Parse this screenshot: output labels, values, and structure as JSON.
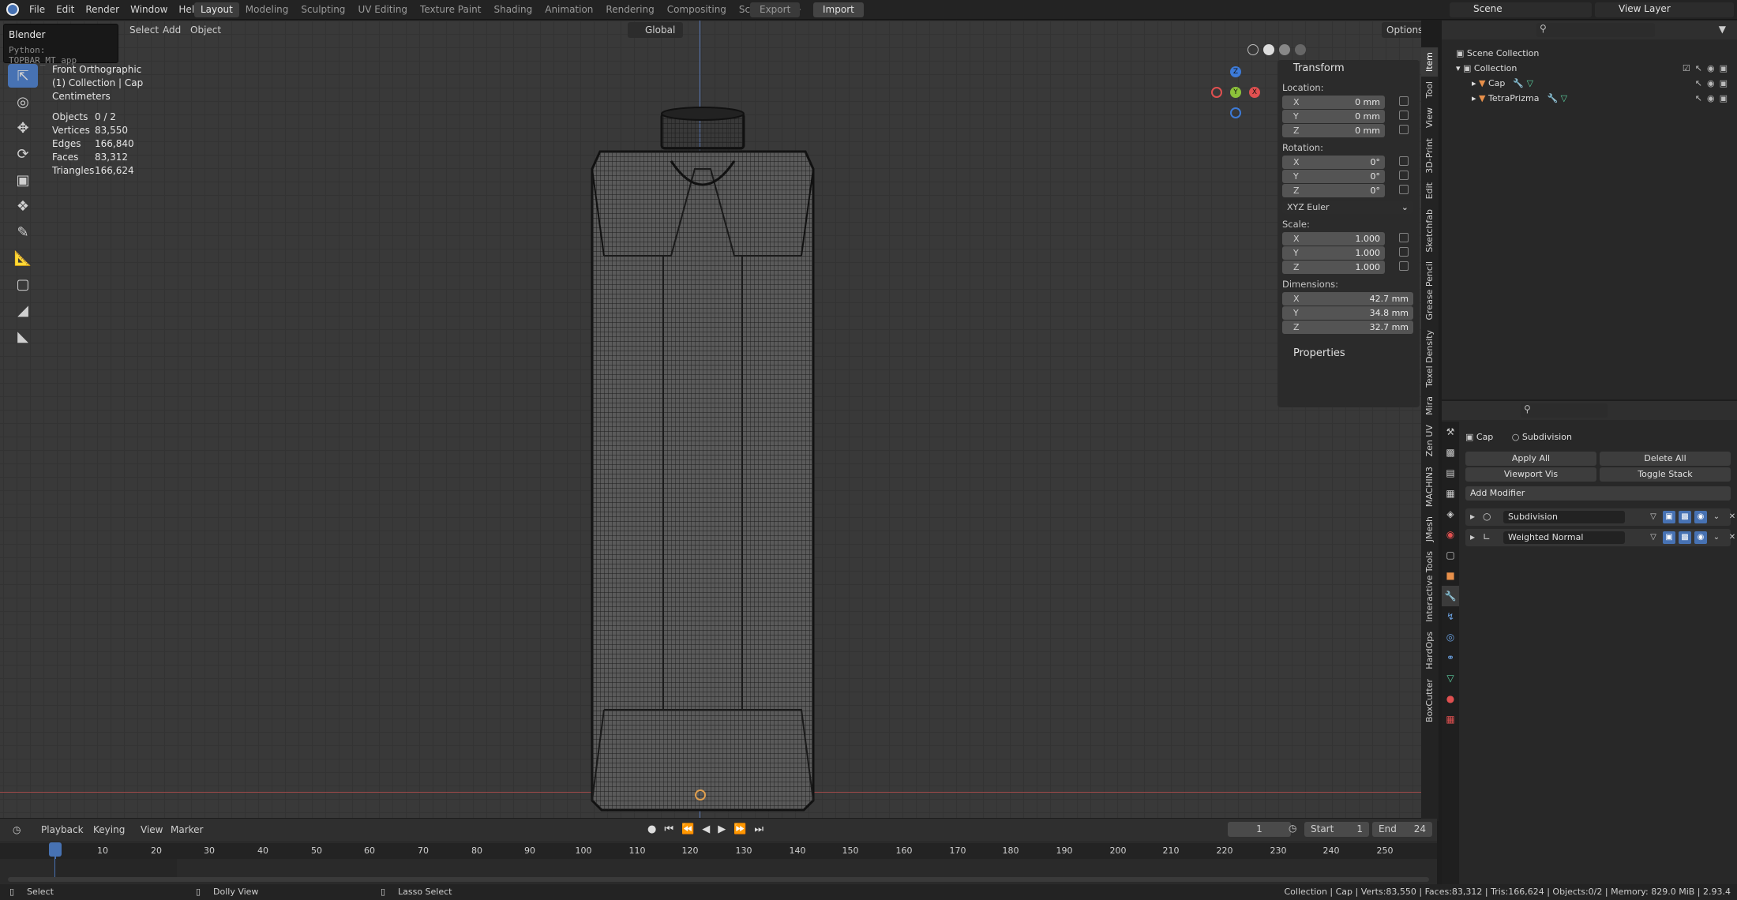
{
  "app": {
    "name": "Blender",
    "tooltip": "Blender",
    "tooltip_python": "Python: TOPBAR_MT_app"
  },
  "menu": [
    "File",
    "Edit",
    "Render",
    "Window",
    "Help"
  ],
  "workspaces": [
    "Layout",
    "Modeling",
    "Sculpting",
    "UV Editing",
    "Texture Paint",
    "Shading",
    "Animation",
    "Rendering",
    "Compositing",
    "Scripting"
  ],
  "active_workspace": "Layout",
  "export_label": "Export",
  "import_label": "Import",
  "scene": {
    "label": "Scene",
    "view_layer": "View Layer"
  },
  "viewport": {
    "header": {
      "select": "Select",
      "add": "Add",
      "object": "Object",
      "orientation": "Global",
      "options": "Options"
    },
    "overlay": {
      "view": "Front Orthographic",
      "collection": "(1) Collection | Cap",
      "units": "Centimeters"
    },
    "stats": [
      {
        "k": "Objects",
        "v": "0 / 2"
      },
      {
        "k": "Vertices",
        "v": "83,550"
      },
      {
        "k": "Edges",
        "v": "166,840"
      },
      {
        "k": "Faces",
        "v": "83,312"
      },
      {
        "k": "Triangles",
        "v": "166,624"
      }
    ]
  },
  "npanel": {
    "title": "Transform",
    "location_label": "Location:",
    "location": [
      {
        "a": "X",
        "v": "0 mm"
      },
      {
        "a": "Y",
        "v": "0 mm"
      },
      {
        "a": "Z",
        "v": "0 mm"
      }
    ],
    "rotation_label": "Rotation:",
    "rotation": [
      {
        "a": "X",
        "v": "0°"
      },
      {
        "a": "Y",
        "v": "0°"
      },
      {
        "a": "Z",
        "v": "0°"
      }
    ],
    "rotation_mode": "XYZ Euler",
    "scale_label": "Scale:",
    "scale": [
      {
        "a": "X",
        "v": "1.000"
      },
      {
        "a": "Y",
        "v": "1.000"
      },
      {
        "a": "Z",
        "v": "1.000"
      }
    ],
    "dimensions_label": "Dimensions:",
    "dimensions": [
      {
        "a": "X",
        "v": "42.7 mm"
      },
      {
        "a": "Y",
        "v": "34.8 mm"
      },
      {
        "a": "Z",
        "v": "32.7 mm"
      }
    ],
    "properties_label": "Properties"
  },
  "side_tabs": [
    "Item",
    "Tool",
    "View",
    "3D-Print",
    "Edit",
    "Sketchfab",
    "Grease Pencil",
    "Texel Density",
    "Mira",
    "Zen UV",
    "MACHIN3",
    "JMesh",
    "Interactive Tools",
    "HardOps",
    "BoxCutter"
  ],
  "outliner": {
    "root": "Scene Collection",
    "collection": "Collection",
    "items": [
      "Cap",
      "TetraPrizma"
    ]
  },
  "properties": {
    "object": "Cap",
    "modifier_context": "Subdivision",
    "apply_all": "Apply All",
    "delete_all": "Delete All",
    "viewport_vis": "Viewport Vis",
    "toggle_stack": "Toggle Stack",
    "add_modifier": "Add Modifier",
    "modifiers": [
      "Subdivision",
      "Weighted Normal"
    ]
  },
  "timeline": {
    "playback": "Playback",
    "keying": "Keying",
    "view": "View",
    "marker": "Marker",
    "current_frame": "1",
    "start_label": "Start",
    "start": "1",
    "end_label": "End",
    "end": "24",
    "ticks": [
      "1",
      "10",
      "20",
      "30",
      "40",
      "50",
      "60",
      "70",
      "80",
      "90",
      "100",
      "110",
      "120",
      "130",
      "140",
      "150",
      "160",
      "170",
      "180",
      "190",
      "200",
      "210",
      "220",
      "230",
      "240",
      "250"
    ]
  },
  "statusbar": {
    "select": "Select",
    "dolly": "Dolly View",
    "lasso": "Lasso Select",
    "info": "Collection | Cap | Verts:83,550 | Faces:83,312 | Tris:166,624 | Objects:0/2 | Memory: 829.0 MiB | 2.93.4"
  },
  "colors": {
    "accent": "#4772b3",
    "axis_x": "#e05050",
    "axis_y": "#8cc23a",
    "axis_z": "#3d7bd8"
  }
}
